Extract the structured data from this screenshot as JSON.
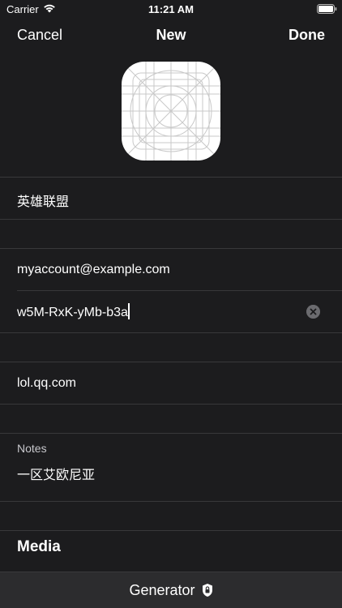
{
  "status_bar": {
    "carrier": "Carrier",
    "time": "11:21 AM"
  },
  "nav": {
    "cancel_label": "Cancel",
    "title": "New",
    "done_label": "Done"
  },
  "form": {
    "title_value": "英雄联盟",
    "account_value": "myaccount@example.com",
    "password_value": "w5M-RxK-yMb-b3a",
    "website_value": "lol.qq.com",
    "notes_label": "Notes",
    "notes_value": "一区艾欧尼亚",
    "media_heading": "Media"
  },
  "toolbar": {
    "generator_label": "Generator"
  },
  "colors": {
    "background": "#1c1c1e",
    "toolbar": "#2c2c2e",
    "separator": "#38383a",
    "text": "#ffffff",
    "secondary_text": "#c7c7cc"
  },
  "icons": [
    "wifi-icon",
    "battery-icon",
    "app-icon-grid",
    "clear-icon",
    "lock-icon"
  ]
}
